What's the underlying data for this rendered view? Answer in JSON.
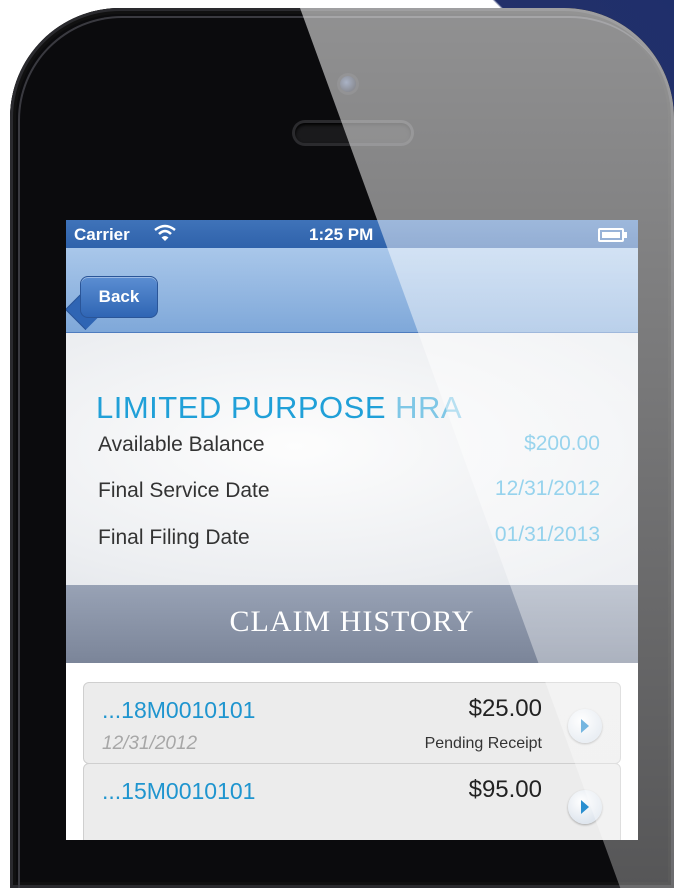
{
  "status_bar": {
    "carrier": "Carrier",
    "time": "1:25 PM",
    "wifi_icon": "wifi-icon",
    "battery_icon": "battery-icon"
  },
  "nav": {
    "back_label": "Back"
  },
  "account": {
    "title_main": "LIMITED PURPOSE",
    "title_suffix": "HRA",
    "rows": [
      {
        "label": "Available Balance",
        "value": "$200.00"
      },
      {
        "label": "Final Service Date",
        "value": "12/31/2012"
      },
      {
        "label": "Final Filing Date",
        "value": "01/31/2013"
      }
    ]
  },
  "history": {
    "title": "CLAIM HISTORY",
    "claims": [
      {
        "id": "...18M0010101",
        "amount": "$25.00",
        "date": "12/31/2012",
        "status": "Pending Receipt"
      },
      {
        "id": "...15M0010101",
        "amount": "$95.00",
        "date": "",
        "status": ""
      }
    ]
  },
  "colors": {
    "accent": "#20a0d8",
    "navbar": "#7fa8d9",
    "header": "#8a93a8"
  }
}
